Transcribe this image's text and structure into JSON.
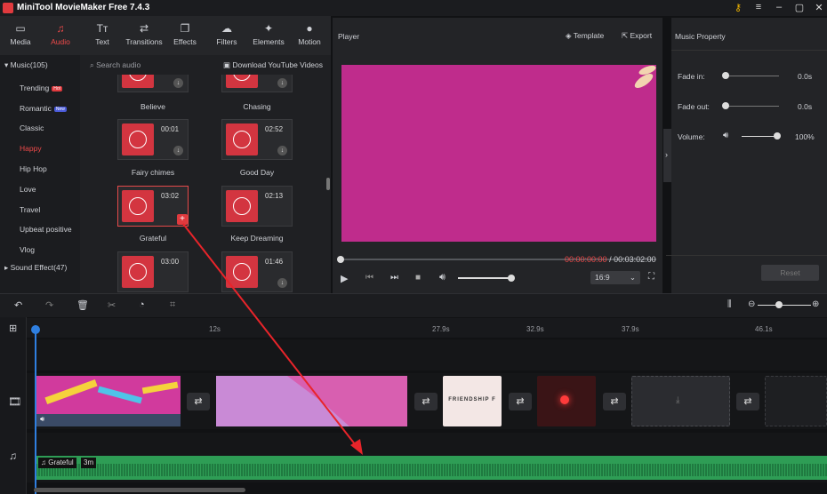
{
  "app": {
    "title": "MiniTool MovieMaker Free 7.4.3"
  },
  "toolbar": {
    "tabs": [
      {
        "label": "Media",
        "icon": "media-icon"
      },
      {
        "label": "Audio",
        "icon": "audio-icon"
      },
      {
        "label": "Text",
        "icon": "text-icon"
      },
      {
        "label": "Transitions",
        "icon": "transitions-icon"
      },
      {
        "label": "Effects",
        "icon": "effects-icon"
      },
      {
        "label": "Filters",
        "icon": "filters-icon"
      },
      {
        "label": "Elements",
        "icon": "elements-icon"
      },
      {
        "label": "Motion",
        "icon": "motion-icon"
      }
    ],
    "active": "Audio"
  },
  "categories": {
    "music_group": "Music(105)",
    "items": [
      "Trending",
      "Romantic",
      "Classic",
      "Happy",
      "Hip Hop",
      "Love",
      "Travel",
      "Upbeat positive",
      "Vlog"
    ],
    "selected": "Happy",
    "badges": {
      "Trending": "Hot",
      "Romantic": "New"
    },
    "sound_group": "Sound Effect(47)"
  },
  "search": {
    "placeholder": "Search audio",
    "youtube": "Download YouTube Videos"
  },
  "music_cards": [
    {
      "name": "Believe",
      "duration": ""
    },
    {
      "name": "Chasing",
      "duration": ""
    },
    {
      "name": "Fairy chimes",
      "duration": "00:01"
    },
    {
      "name": "Good Day",
      "duration": "02:52"
    },
    {
      "name": "Grateful",
      "duration": "03:02"
    },
    {
      "name": "Keep Dreaming",
      "duration": "02:13"
    },
    {
      "name": "",
      "duration": "03:00"
    },
    {
      "name": "",
      "duration": "01:46"
    }
  ],
  "player": {
    "label": "Player",
    "template": "Template",
    "export": "Export",
    "time_current": "00:00:00:00",
    "time_separator": "/",
    "time_total": "00:03:02:00",
    "aspect": "16:9"
  },
  "music_property": {
    "title": "Music Property",
    "fade_in_label": "Fade in:",
    "fade_in_value": "0.0s",
    "fade_out_label": "Fade out:",
    "fade_out_value": "0.0s",
    "volume_label": "Volume:",
    "volume_value": "100%",
    "volume_level": 1.0,
    "reset": "Reset"
  },
  "ruler": {
    "ticks": [
      "0",
      "12s",
      "27.9s",
      "32.9s",
      "37.9s",
      "46.1s"
    ]
  },
  "video_track": {
    "clips": [
      {
        "text": ""
      },
      {
        "text": ""
      },
      {
        "text": "FRIENDSHIP F"
      },
      {
        "text": ""
      },
      {
        "text": ""
      },
      {
        "text": ""
      }
    ]
  },
  "audio_track": {
    "clip_name": "Grateful",
    "clip_length": "3m"
  },
  "colors": {
    "accent": "#ef4a4a",
    "playhead": "#2f7fe0",
    "audio": "#2e9d55",
    "video_bg": "#bf2c8c"
  }
}
